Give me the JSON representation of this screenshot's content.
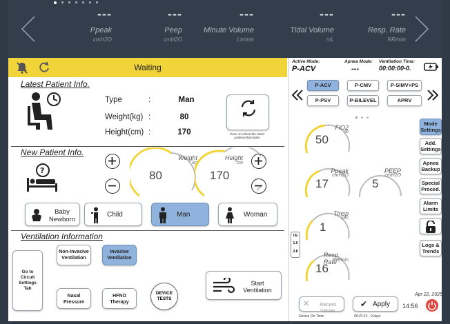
{
  "top": {
    "page_dots": 7,
    "metrics": [
      {
        "value": "---",
        "name": "Ppeak",
        "unit": "cmH2O"
      },
      {
        "value": "---",
        "name": "Peep",
        "unit": "cmH2O"
      },
      {
        "value": "---",
        "name": "Minute Volume",
        "unit": "Ltr/min"
      },
      {
        "value": "---",
        "name": "Tidal Volume",
        "unit": "mL"
      },
      {
        "value": "---",
        "name": "Resp. Rate",
        "unit": "RR/min"
      }
    ]
  },
  "status": {
    "text": "Waiting",
    "bar_color": "#f0d43a"
  },
  "latest": {
    "title": "Latest Patient Info.",
    "type_label": "Type",
    "type_value": "Man",
    "weight_label": "Weight(kg)",
    "weight_value": "80",
    "height_label": "Height(cm)",
    "height_value": "170",
    "colon": ":",
    "reload_caption": "Press to reload the latest patient information"
  },
  "new_patient": {
    "title": "New Patient Info.",
    "weight_label": "Weight",
    "weight_unit": "kg",
    "weight_value": "80",
    "height_label": "Height",
    "height_unit": "cm",
    "height_value": "170",
    "types": [
      {
        "label": "Baby Newborn",
        "selected": false
      },
      {
        "label": "Child",
        "selected": false
      },
      {
        "label": "Man",
        "selected": true
      },
      {
        "label": "Woman",
        "selected": false
      }
    ]
  },
  "ventilation_info": {
    "title": "Ventilation Information",
    "circuit_button": "Go to Circuit Settings Tab",
    "non_invasive": "Non-Invasive Ventilation",
    "invasive": "Invasive Ventilation",
    "nasal": "Nasal Pressure",
    "hfno": "HFNO Therapy",
    "device_tests": "DEVICE TESTS",
    "start": "Start Ventilation"
  },
  "right": {
    "active_mode_label": "Active Mode:",
    "active_mode_value": "P-ACV",
    "apnea_mode_label": "Apnea Mode:",
    "apnea_mode_value": "---",
    "vent_time_label": "Ventilation Time:",
    "vent_time_value": "00:00:00-0.",
    "modes_row1": [
      "P-ACV",
      "P-CMV",
      "P-SIMV+PS"
    ],
    "modes_row2": [
      "P-PSV",
      "P-BiLEVEL",
      "APRV"
    ],
    "selected_mode": "P-ACV",
    "gauges": {
      "fio2": {
        "label": "FiO2",
        "unit": "%",
        "value": "50"
      },
      "ppeak": {
        "label": "Ppeak",
        "unit": "cmH2O",
        "value": "17"
      },
      "peep": {
        "label": "PEEP",
        "unit": "cmH2O",
        "value": "5"
      },
      "tinsp": {
        "label": "Tinsp",
        "unit": "sec",
        "value": "1"
      },
      "rr": {
        "label": "Resp. Rate",
        "unit": "RR/min",
        "value": "16"
      }
    },
    "ie": {
      "label": "I:E",
      "top": "1.0",
      "bottom": "2.8"
    },
    "side_buttons": [
      "Mode Settings",
      "Add. Settings",
      "Apnea Backup",
      "Special Proced.",
      "Alarm Limits",
      "",
      "Logs & Trends"
    ],
    "recent_values": "Recent Values",
    "apply": "Apply",
    "date": "Apr 22, 2025",
    "time": "14:56",
    "device_on_label": "Device On Time:",
    "device_on_value": "00:41:14 - 0.days",
    "accent": "#f0d43a",
    "select_blue": "#8fb3dd",
    "power_red": "#e0443c"
  }
}
